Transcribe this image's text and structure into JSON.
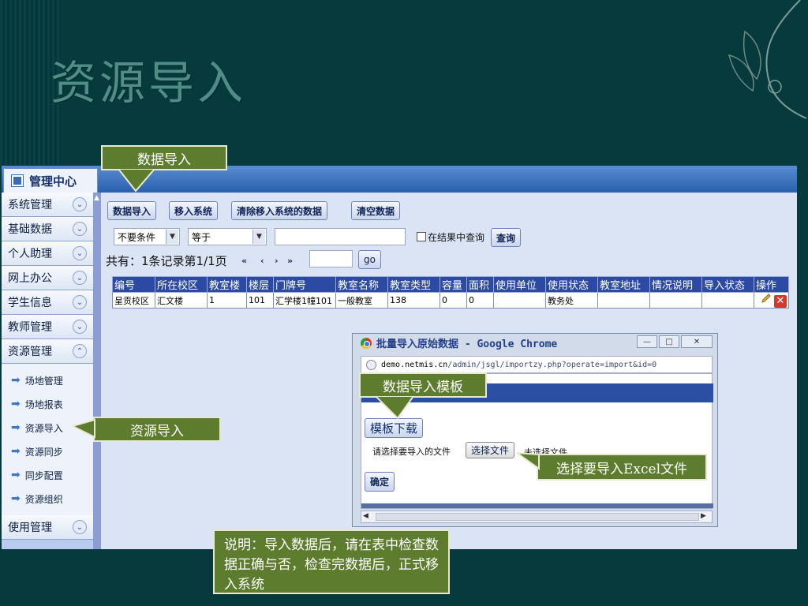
{
  "slide": {
    "title": "资源导入"
  },
  "app": {
    "center_tab": "管理中心",
    "sidebar": {
      "menus": [
        "系统管理",
        "基础数据",
        "个人助理",
        "网上办公",
        "学生信息",
        "教师管理",
        "资源管理"
      ],
      "chev_down": "⌄",
      "chev_up": "⌃",
      "sub_items": [
        "场地管理",
        "场地报表",
        "资源导入",
        "资源同步",
        "同步配置",
        "资源组织"
      ],
      "last_menu": "使用管理"
    },
    "toolbar": {
      "import": "数据导入",
      "move": "移入系统",
      "clear_moved": "清除移入系统的数据",
      "clear_all": "清空数据"
    },
    "filter": {
      "condition": "不要条件",
      "operator": "等于",
      "value": "",
      "in_results": "在结果中查询",
      "query": "查询"
    },
    "pager": {
      "summary": "共有：1条记录第1/1页",
      "first": "«",
      "prev": "‹",
      "next": "›",
      "last": "»",
      "page_input": "",
      "go": "go"
    },
    "table": {
      "headers": [
        "编号",
        "所在校区",
        "教室楼",
        "楼层",
        "门牌号",
        "教室名称",
        "教室类型",
        "容量",
        "面积",
        "使用单位",
        "使用状态",
        "教室地址",
        "情况说明",
        "导入状态",
        "操作"
      ],
      "rows": [
        [
          "呈贡校区",
          "汇文楼",
          "1",
          "101",
          "汇学楼1幢101",
          "一般教室",
          "138",
          "0",
          "0",
          "",
          "教务处",
          "",
          "",
          ""
        ]
      ]
    }
  },
  "popup": {
    "title": "批量导入原始数据 - Google Chrome",
    "url_host": "demo.netmis.cn",
    "url_path": "/admin/jsgl/importzy.php?operate=import&id=0",
    "download_template": "模板下载",
    "choose_label": "请选择要导入的文件",
    "choose_button": "选择文件",
    "no_file": "未选择文件",
    "confirm": "确定",
    "win_min": "—",
    "win_max": "□",
    "win_close": "✕"
  },
  "callouts": {
    "data_import": "数据导入",
    "resource_import": "资源导入",
    "template": "数据导入模板",
    "choose_excel": "选择要导入Excel文件",
    "note": "说明：导入数据后，请在表中检查数据正确与否，检查完数据后，正式移入系统"
  }
}
